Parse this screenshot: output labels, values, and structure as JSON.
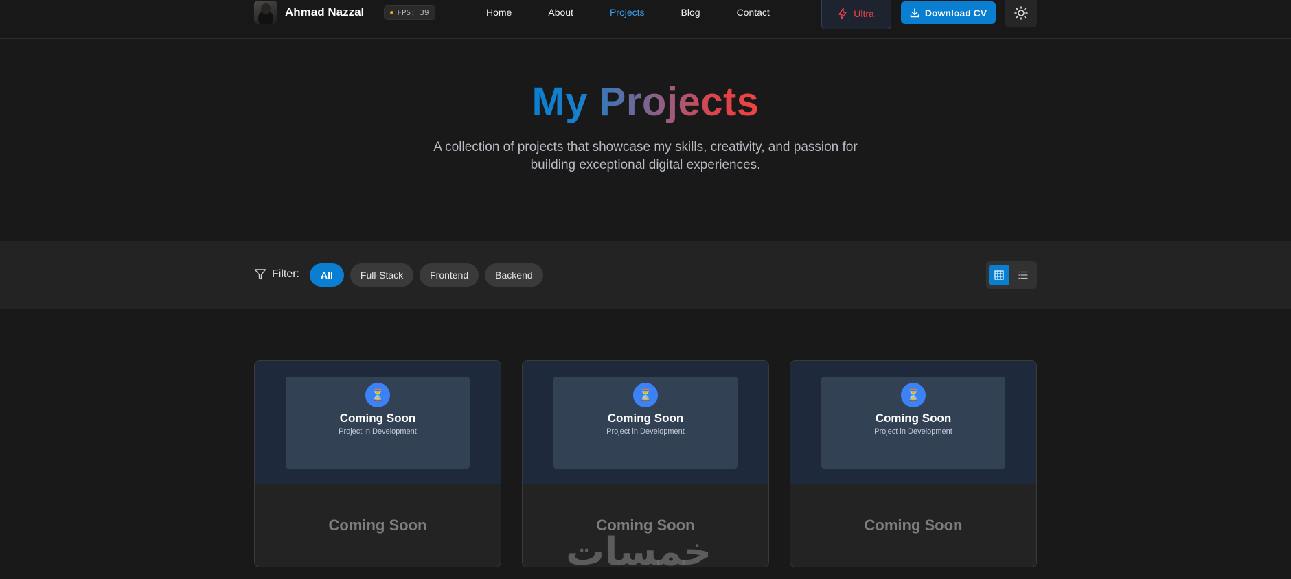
{
  "nav": {
    "brand_name": "Ahmad Nazzal",
    "fps_label": "FPS: 39",
    "links": [
      "Home",
      "About",
      "Projects",
      "Blog",
      "Contact"
    ],
    "active_link": "Projects",
    "ultra_label": "Ultra",
    "download_label": "Download CV",
    "theme_icon": "sun-icon"
  },
  "hero": {
    "title": "My Projects",
    "subtitle": "A collection of projects that showcase my skills, creativity, and passion for building exceptional digital experiences."
  },
  "filter": {
    "label": "Filter:",
    "chips": [
      "All",
      "Full-Stack",
      "Frontend",
      "Backend"
    ],
    "active_chip": "All",
    "view_modes": [
      "grid-icon",
      "list-icon"
    ],
    "active_view": "grid"
  },
  "projects": [
    {
      "placeholder_title": "Coming Soon",
      "placeholder_subtitle": "Project in Development",
      "title": "Coming Soon"
    },
    {
      "placeholder_title": "Coming Soon",
      "placeholder_subtitle": "Project in Development",
      "title": "Coming Soon"
    },
    {
      "placeholder_title": "Coming Soon",
      "placeholder_subtitle": "Project in Development",
      "title": "Coming Soon"
    }
  ],
  "watermark": "خمسات",
  "colors": {
    "accent": "#0a7fd1",
    "ultra": "#ef4444",
    "background": "#191919",
    "card_top": "#1e293b"
  }
}
